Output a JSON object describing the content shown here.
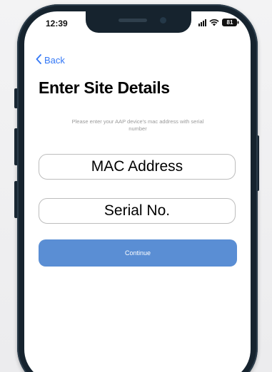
{
  "status_bar": {
    "time": "12:39",
    "battery_level": "81"
  },
  "nav": {
    "back_label": "Back"
  },
  "page": {
    "title": "Enter Site Details",
    "instruction": "Please enter your AAP device's mac address with serial number"
  },
  "form": {
    "mac_placeholder": "MAC Address",
    "serial_placeholder": "Serial No.",
    "continue_label": "Continue"
  },
  "colors": {
    "accent": "#3478f6",
    "continue_button": "#5a8ed4",
    "phone_frame": "#16232e"
  },
  "icons": [
    "chevron-left-icon",
    "signal-icon",
    "wifi-icon",
    "battery-icon"
  ]
}
